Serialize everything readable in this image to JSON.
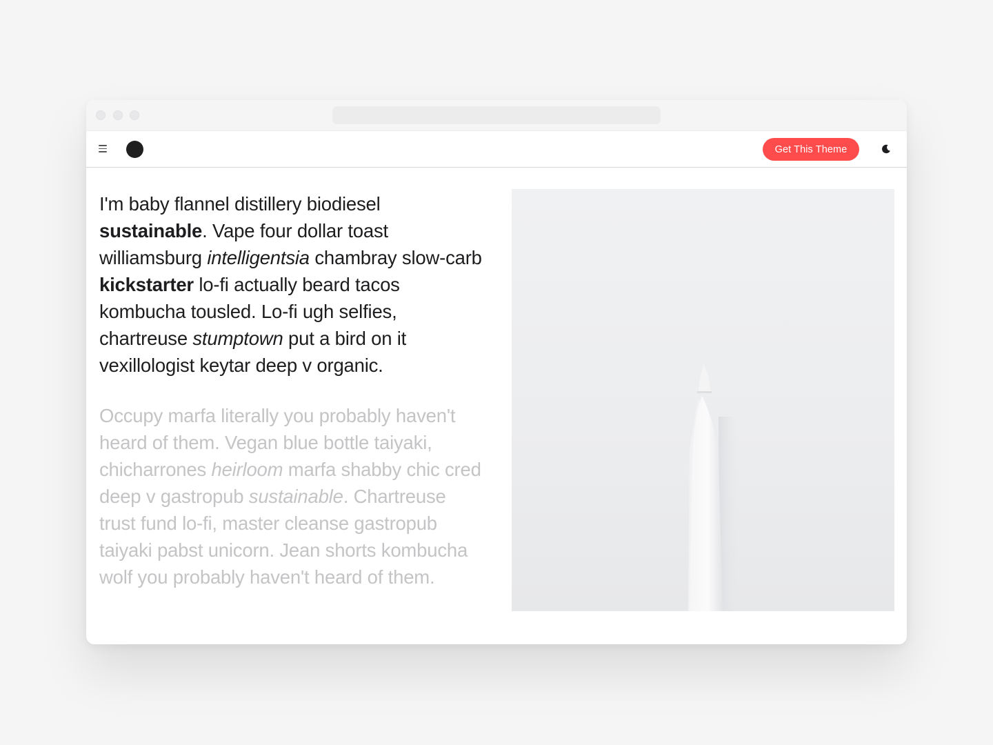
{
  "window": {
    "traffic_lights": [
      "close",
      "minimize",
      "zoom"
    ]
  },
  "navbar": {
    "menu_icon": "hamburger-menu-icon",
    "logo": "circle-logo",
    "cta_label": "Get This Theme",
    "cta_color": "#fe4c4c",
    "theme_toggle_icon": "moon-icon"
  },
  "article": {
    "paragraph1": {
      "s1": "I'm baby flannel distillery biodiesel ",
      "s2_bold": "sustainable",
      "s3": ". Vape four dollar toast williamsburg ",
      "s4_italic": "intelligentsia",
      "s5": " chambray slow-carb ",
      "s6_bold": "kickstarter",
      "s7": " lo-fi actually beard tacos kombucha tousled. Lo-fi ugh selfies, chartreuse ",
      "s8_italic": "stumptown",
      "s9": " put a bird on it vexillologist keytar deep v organic."
    },
    "paragraph2": {
      "s1": "Occupy marfa literally you probably haven't heard of them. Vegan blue bottle taiyaki, chicharrones ",
      "s2_italic": "heirloom",
      "s3": " marfa shabby chic cred deep v gastropub ",
      "s4_italic": "sustainable",
      "s5": ". Chartreuse trust fund lo-fi, master cleanse gastropub taiyaki pabst unicorn. Jean shorts kombucha wolf you probably haven't heard of them."
    },
    "image": "white-stylus-photo"
  }
}
